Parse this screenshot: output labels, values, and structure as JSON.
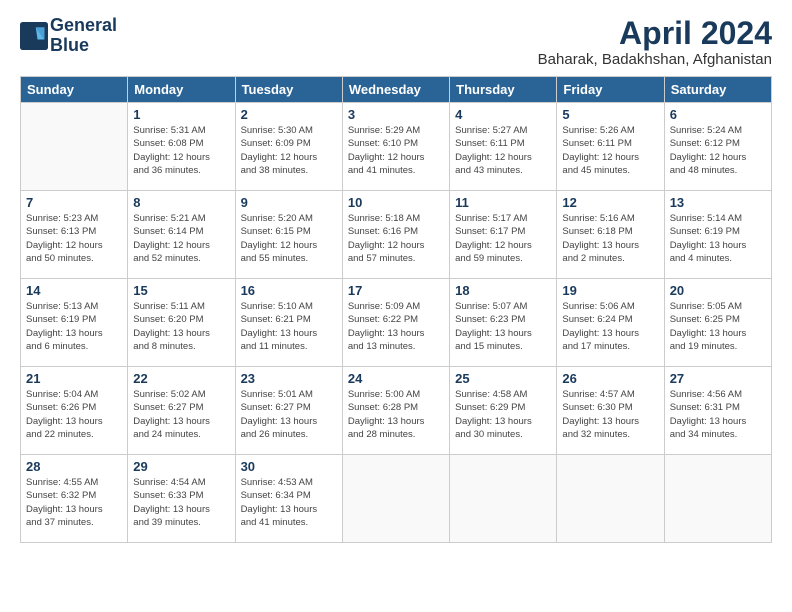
{
  "logo": {
    "line1": "General",
    "line2": "Blue"
  },
  "title": "April 2024",
  "location": "Baharak, Badakhshan, Afghanistan",
  "headers": [
    "Sunday",
    "Monday",
    "Tuesday",
    "Wednesday",
    "Thursday",
    "Friday",
    "Saturday"
  ],
  "weeks": [
    [
      {
        "day": "",
        "info": ""
      },
      {
        "day": "1",
        "info": "Sunrise: 5:31 AM\nSunset: 6:08 PM\nDaylight: 12 hours\nand 36 minutes."
      },
      {
        "day": "2",
        "info": "Sunrise: 5:30 AM\nSunset: 6:09 PM\nDaylight: 12 hours\nand 38 minutes."
      },
      {
        "day": "3",
        "info": "Sunrise: 5:29 AM\nSunset: 6:10 PM\nDaylight: 12 hours\nand 41 minutes."
      },
      {
        "day": "4",
        "info": "Sunrise: 5:27 AM\nSunset: 6:11 PM\nDaylight: 12 hours\nand 43 minutes."
      },
      {
        "day": "5",
        "info": "Sunrise: 5:26 AM\nSunset: 6:11 PM\nDaylight: 12 hours\nand 45 minutes."
      },
      {
        "day": "6",
        "info": "Sunrise: 5:24 AM\nSunset: 6:12 PM\nDaylight: 12 hours\nand 48 minutes."
      }
    ],
    [
      {
        "day": "7",
        "info": "Sunrise: 5:23 AM\nSunset: 6:13 PM\nDaylight: 12 hours\nand 50 minutes."
      },
      {
        "day": "8",
        "info": "Sunrise: 5:21 AM\nSunset: 6:14 PM\nDaylight: 12 hours\nand 52 minutes."
      },
      {
        "day": "9",
        "info": "Sunrise: 5:20 AM\nSunset: 6:15 PM\nDaylight: 12 hours\nand 55 minutes."
      },
      {
        "day": "10",
        "info": "Sunrise: 5:18 AM\nSunset: 6:16 PM\nDaylight: 12 hours\nand 57 minutes."
      },
      {
        "day": "11",
        "info": "Sunrise: 5:17 AM\nSunset: 6:17 PM\nDaylight: 12 hours\nand 59 minutes."
      },
      {
        "day": "12",
        "info": "Sunrise: 5:16 AM\nSunset: 6:18 PM\nDaylight: 13 hours\nand 2 minutes."
      },
      {
        "day": "13",
        "info": "Sunrise: 5:14 AM\nSunset: 6:19 PM\nDaylight: 13 hours\nand 4 minutes."
      }
    ],
    [
      {
        "day": "14",
        "info": "Sunrise: 5:13 AM\nSunset: 6:19 PM\nDaylight: 13 hours\nand 6 minutes."
      },
      {
        "day": "15",
        "info": "Sunrise: 5:11 AM\nSunset: 6:20 PM\nDaylight: 13 hours\nand 8 minutes."
      },
      {
        "day": "16",
        "info": "Sunrise: 5:10 AM\nSunset: 6:21 PM\nDaylight: 13 hours\nand 11 minutes."
      },
      {
        "day": "17",
        "info": "Sunrise: 5:09 AM\nSunset: 6:22 PM\nDaylight: 13 hours\nand 13 minutes."
      },
      {
        "day": "18",
        "info": "Sunrise: 5:07 AM\nSunset: 6:23 PM\nDaylight: 13 hours\nand 15 minutes."
      },
      {
        "day": "19",
        "info": "Sunrise: 5:06 AM\nSunset: 6:24 PM\nDaylight: 13 hours\nand 17 minutes."
      },
      {
        "day": "20",
        "info": "Sunrise: 5:05 AM\nSunset: 6:25 PM\nDaylight: 13 hours\nand 19 minutes."
      }
    ],
    [
      {
        "day": "21",
        "info": "Sunrise: 5:04 AM\nSunset: 6:26 PM\nDaylight: 13 hours\nand 22 minutes."
      },
      {
        "day": "22",
        "info": "Sunrise: 5:02 AM\nSunset: 6:27 PM\nDaylight: 13 hours\nand 24 minutes."
      },
      {
        "day": "23",
        "info": "Sunrise: 5:01 AM\nSunset: 6:27 PM\nDaylight: 13 hours\nand 26 minutes."
      },
      {
        "day": "24",
        "info": "Sunrise: 5:00 AM\nSunset: 6:28 PM\nDaylight: 13 hours\nand 28 minutes."
      },
      {
        "day": "25",
        "info": "Sunrise: 4:58 AM\nSunset: 6:29 PM\nDaylight: 13 hours\nand 30 minutes."
      },
      {
        "day": "26",
        "info": "Sunrise: 4:57 AM\nSunset: 6:30 PM\nDaylight: 13 hours\nand 32 minutes."
      },
      {
        "day": "27",
        "info": "Sunrise: 4:56 AM\nSunset: 6:31 PM\nDaylight: 13 hours\nand 34 minutes."
      }
    ],
    [
      {
        "day": "28",
        "info": "Sunrise: 4:55 AM\nSunset: 6:32 PM\nDaylight: 13 hours\nand 37 minutes."
      },
      {
        "day": "29",
        "info": "Sunrise: 4:54 AM\nSunset: 6:33 PM\nDaylight: 13 hours\nand 39 minutes."
      },
      {
        "day": "30",
        "info": "Sunrise: 4:53 AM\nSunset: 6:34 PM\nDaylight: 13 hours\nand 41 minutes."
      },
      {
        "day": "",
        "info": ""
      },
      {
        "day": "",
        "info": ""
      },
      {
        "day": "",
        "info": ""
      },
      {
        "day": "",
        "info": ""
      }
    ]
  ]
}
